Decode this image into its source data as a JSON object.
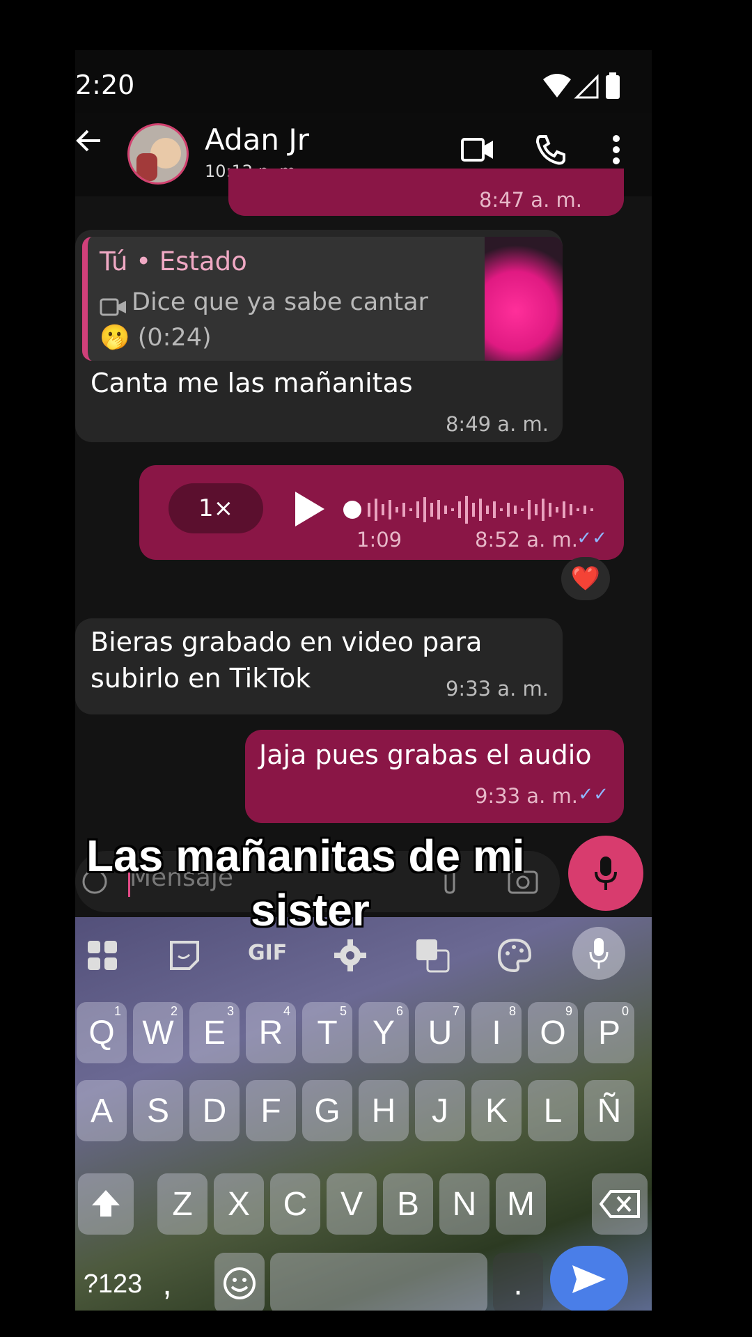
{
  "status_bar": {
    "time": "2:20"
  },
  "header": {
    "contact_name": "Adan Jr",
    "last_seen": "10:12 p. m."
  },
  "partial_message": {
    "time": "8:47 a. m."
  },
  "message_1": {
    "reply_author": "Tú • Estado",
    "reply_text": "Dice que ya sabe cantar",
    "reply_duration": "🫢 (0:24)",
    "text": "Canta me las mañanitas",
    "time": "8:49 a. m."
  },
  "voice_message": {
    "speed": "1×",
    "duration": "1:09",
    "time": "8:52 a. m.",
    "reaction": "❤️"
  },
  "message_2": {
    "text_line1": "Bieras grabado en video para",
    "text_line2": "subirlo en TikTok",
    "time": "9:33 a. m."
  },
  "message_3": {
    "text": "Jaja pues grabas el audio",
    "time": "9:33 a. m."
  },
  "composer": {
    "placeholder": "Mensaje"
  },
  "overlay": {
    "line1": "Las mañanitas de mi",
    "line2": "sister"
  },
  "keyboard": {
    "toolbar_gif": "GIF",
    "row1": [
      {
        "k": "Q",
        "n": "1"
      },
      {
        "k": "W",
        "n": "2"
      },
      {
        "k": "E",
        "n": "3"
      },
      {
        "k": "R",
        "n": "4"
      },
      {
        "k": "T",
        "n": "5"
      },
      {
        "k": "Y",
        "n": "6"
      },
      {
        "k": "U",
        "n": "7"
      },
      {
        "k": "I",
        "n": "8"
      },
      {
        "k": "O",
        "n": "9"
      },
      {
        "k": "P",
        "n": "0"
      }
    ],
    "row2": [
      "A",
      "S",
      "D",
      "F",
      "G",
      "H",
      "J",
      "K",
      "L",
      "Ñ"
    ],
    "row3": [
      "Z",
      "X",
      "C",
      "V",
      "B",
      "N",
      "M"
    ],
    "symbols": "?123",
    "comma": ",",
    "period": "."
  }
}
